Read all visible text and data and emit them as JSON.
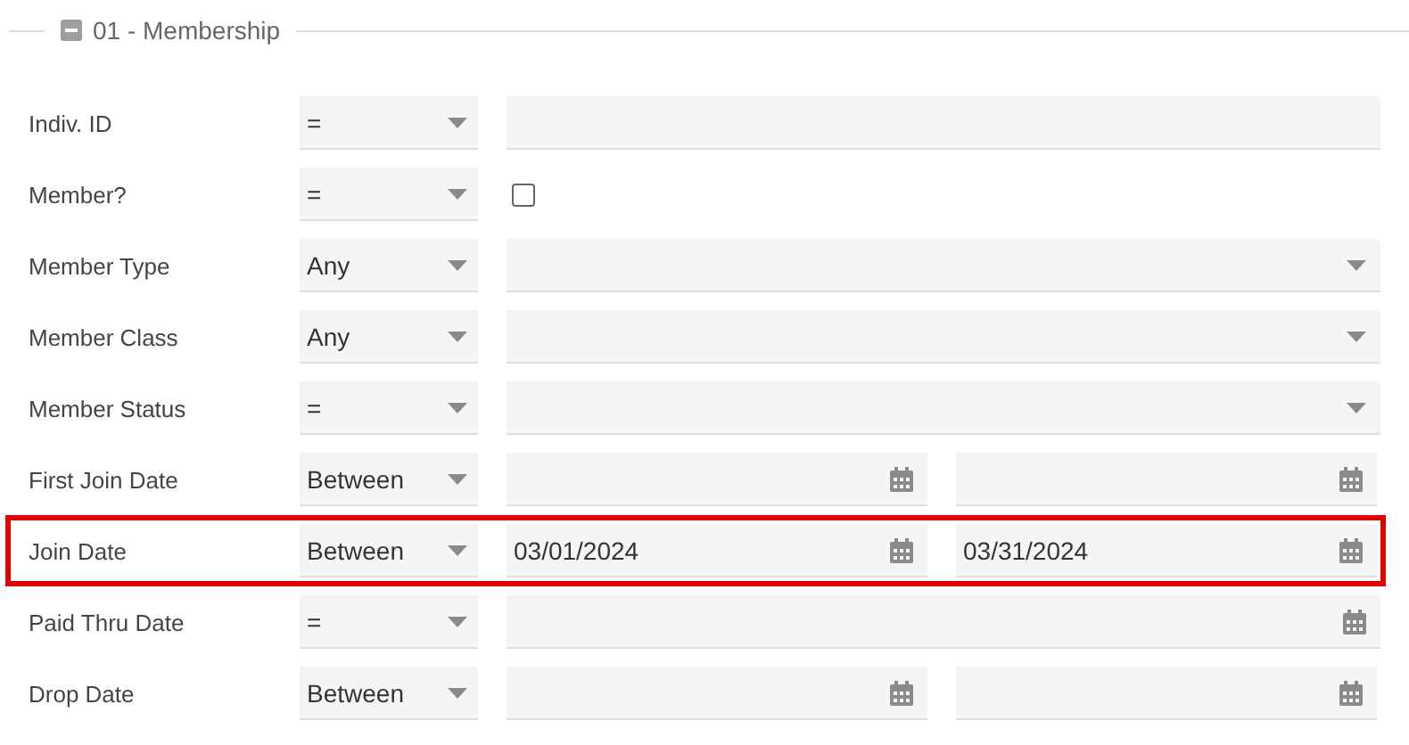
{
  "section": {
    "title": "01 - Membership",
    "expanded": true
  },
  "rows": [
    {
      "label": "Indiv. ID",
      "operator": "=",
      "kind": "text",
      "value": "",
      "highlighted": false
    },
    {
      "label": "Member?",
      "operator": "=",
      "kind": "checkbox",
      "checked": false,
      "highlighted": false
    },
    {
      "label": "Member Type",
      "operator": "Any",
      "kind": "select",
      "highlighted": false
    },
    {
      "label": "Member Class",
      "operator": "Any",
      "kind": "select",
      "highlighted": false
    },
    {
      "label": "Member Status",
      "operator": "=",
      "kind": "select",
      "highlighted": false
    },
    {
      "label": "First Join Date",
      "operator": "Between",
      "kind": "date_range",
      "from": "",
      "to": "",
      "highlighted": false
    },
    {
      "label": "Join Date",
      "operator": "Between",
      "kind": "date_range",
      "from": "03/01/2024",
      "to": "03/31/2024",
      "highlighted": true
    },
    {
      "label": "Paid Thru Date",
      "operator": "=",
      "kind": "date",
      "value": "",
      "highlighted": false
    },
    {
      "label": "Drop Date",
      "operator": "Between",
      "kind": "date_range",
      "from": "",
      "to": "",
      "highlighted": false
    }
  ]
}
